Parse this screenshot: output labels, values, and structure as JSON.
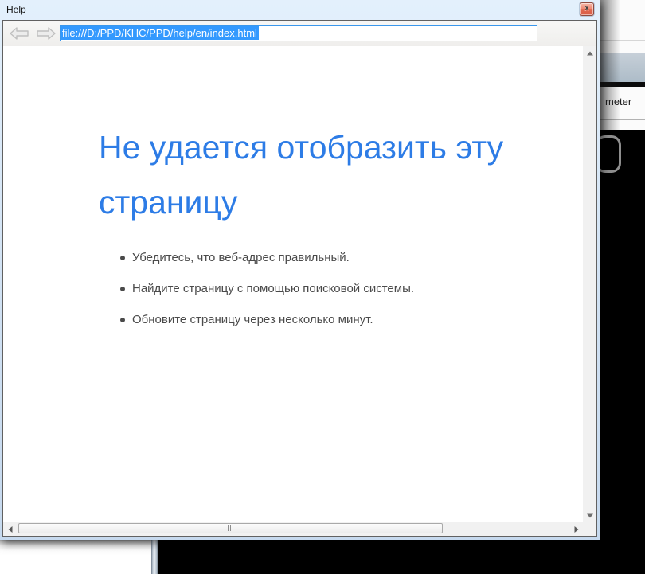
{
  "window": {
    "title": "Help",
    "close_label": "x"
  },
  "toolbar": {
    "address_value": "file:///D:/PPD/KHC/PPD/help/en/index.html"
  },
  "error_page": {
    "title_full": "Не удается отобразить эту страницу",
    "title_lines": [
      "Не удается отобразить эту",
      "страницу"
    ],
    "suggestions": [
      "Убедитесь, что веб-адрес  правильный.",
      "Найдите страницу с помощью поисковой системы.",
      "Обновите страницу через несколько минут."
    ]
  },
  "background": {
    "right_panel_text": "meter"
  },
  "colors": {
    "heading_blue": "#2d7ce6",
    "selection_blue": "#3399fe",
    "titlebar_blue": "#d7e6f7",
    "close_button_red": "#e06a52",
    "body_text": "#4a4a4a"
  }
}
